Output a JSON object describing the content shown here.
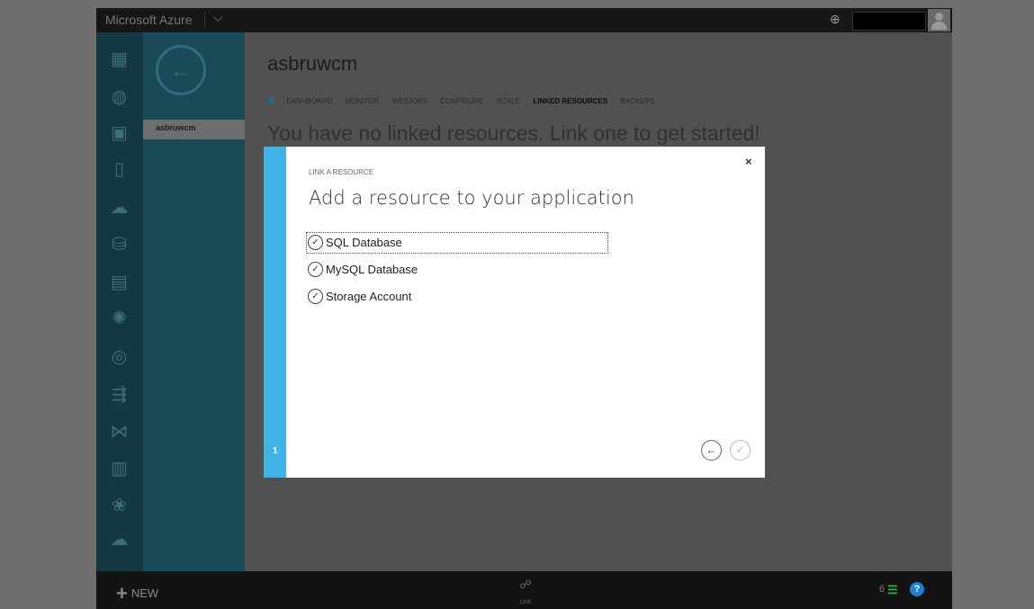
{
  "topbar": {
    "brand": "Microsoft Azure",
    "chevron": "⌵",
    "globe": "⊕"
  },
  "nav": {
    "back_icon": "←",
    "item": "asbruwcm"
  },
  "rail": [
    {
      "name": "all-items-icon",
      "glyph": "▦"
    },
    {
      "name": "web-sites-icon",
      "glyph": "◍"
    },
    {
      "name": "virtual-machines-icon",
      "glyph": "▣"
    },
    {
      "name": "mobile-services-icon",
      "glyph": "▯"
    },
    {
      "name": "cloud-services-icon",
      "glyph": "☁"
    },
    {
      "name": "sql-databases-icon",
      "glyph": "⛁"
    },
    {
      "name": "storage-icon",
      "glyph": "▤"
    },
    {
      "name": "hdinsight-icon",
      "glyph": "✺"
    },
    {
      "name": "media-services-icon",
      "glyph": "◎"
    },
    {
      "name": "service-bus-icon",
      "glyph": "⇶"
    },
    {
      "name": "visual-studio-online-icon",
      "glyph": "⋈"
    },
    {
      "name": "cache-icon",
      "glyph": "▥"
    },
    {
      "name": "biztalk-icon",
      "glyph": "❀"
    },
    {
      "name": "networks-icon",
      "glyph": "☁"
    }
  ],
  "page": {
    "title": "asbruwcm",
    "tab_icon": "☗",
    "tabs": [
      "DASHBOARD",
      "MONITOR",
      "WEBJOBS",
      "CONFIGURE",
      "SCALE",
      "LINKED RESOURCES",
      "BACKUPS"
    ],
    "headline": "You have no linked resources. Link one to get started!"
  },
  "dialog": {
    "subtitle": "LINK A RESOURCE",
    "title": "Add a resource to your application",
    "close": "×",
    "step": "1",
    "check_glyph": "✓",
    "options": [
      "SQL Database",
      "MySQL Database",
      "Storage Account"
    ],
    "back": "←",
    "done": "✓"
  },
  "bottombar": {
    "new_plus": "+",
    "new_label": "NEW",
    "link_icon": "☍",
    "link_label": "LINK",
    "count": "6",
    "list_icon": "☰",
    "help": "?"
  }
}
